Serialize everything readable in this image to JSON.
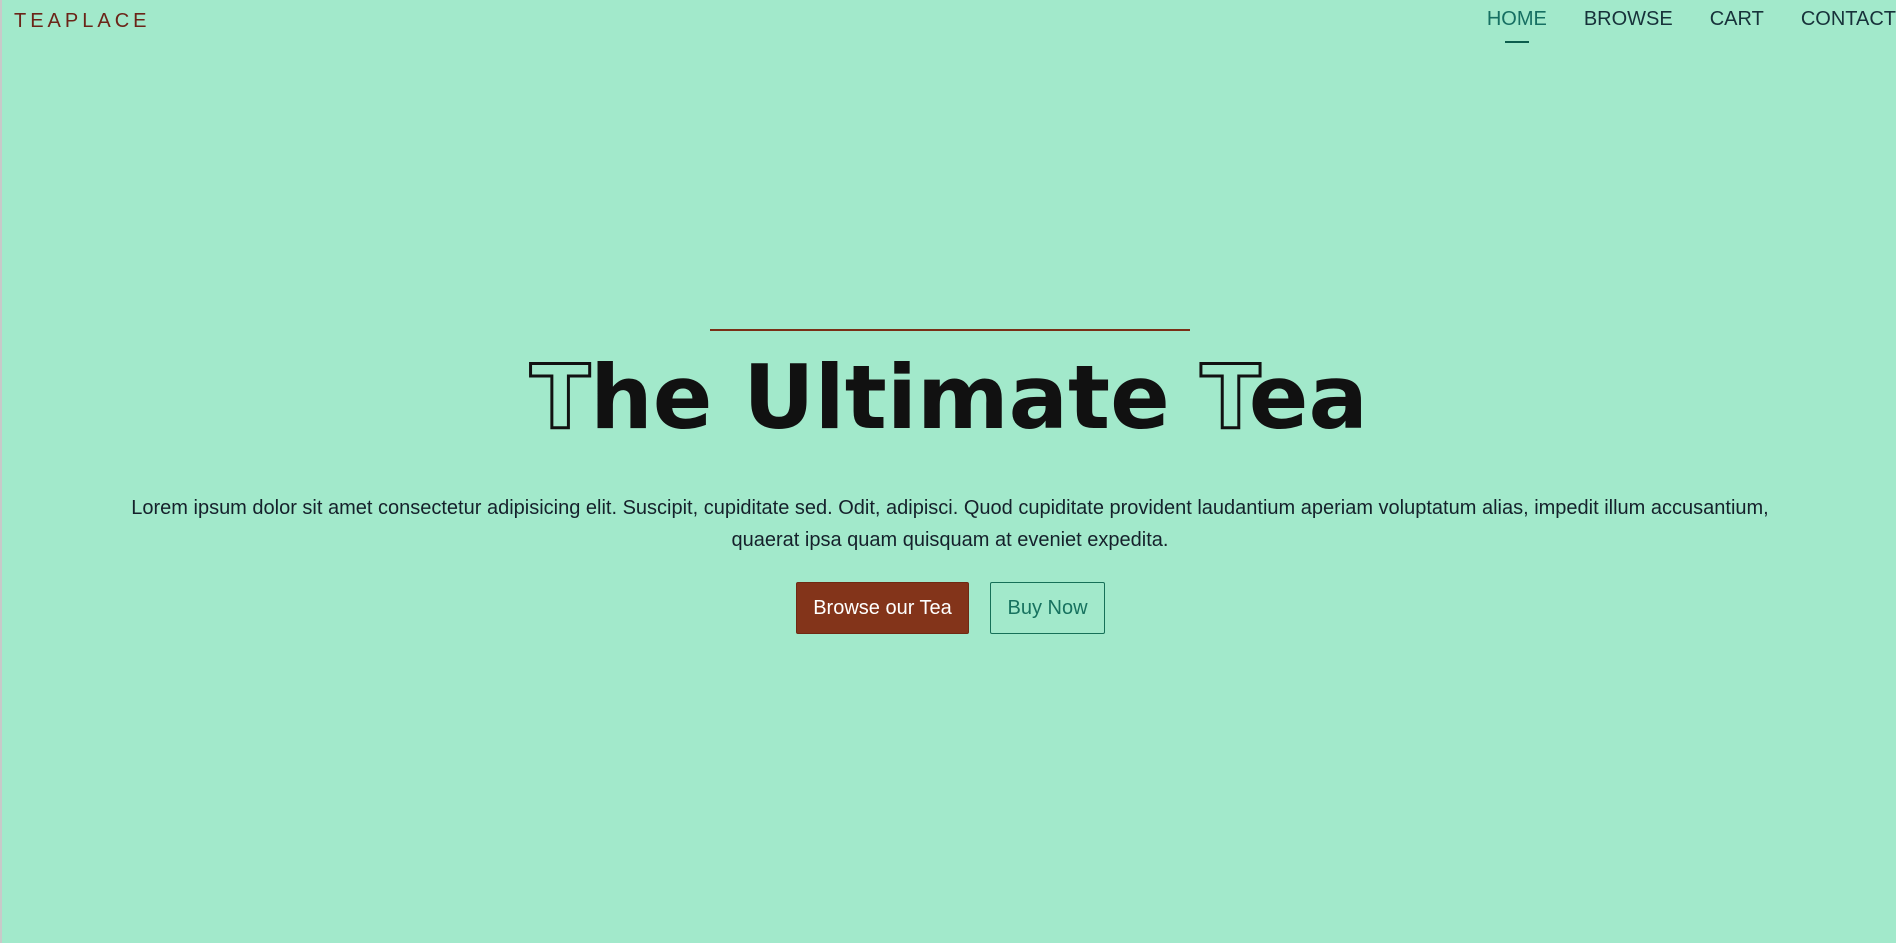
{
  "brand": {
    "name": "TEAPLACE"
  },
  "nav": {
    "items": [
      {
        "label": "HOME",
        "active": true
      },
      {
        "label": "BROWSE",
        "active": false
      },
      {
        "label": "CART",
        "active": false
      },
      {
        "label": "CONTACT",
        "active": false
      }
    ]
  },
  "hero": {
    "title_part1": "T",
    "title_part2": "he Ultimate ",
    "title_part3": "T",
    "title_part4": "ea",
    "description": "Lorem ipsum dolor sit amet consectetur adipisicing elit. Suscipit, cupiditate sed. Odit, adipisci. Quod cupiditate provident laudantium aperiam voluptatum alias, impedit illum accusantium, quaerat ipsa quam quisquam at eveniet expedita.",
    "primary_button": "Browse our Tea",
    "secondary_button": "Buy Now"
  },
  "colors": {
    "background": "#a2e9cb",
    "accent": "#83341a",
    "nav_active": "#166f62",
    "rule": "#7a2f17"
  }
}
